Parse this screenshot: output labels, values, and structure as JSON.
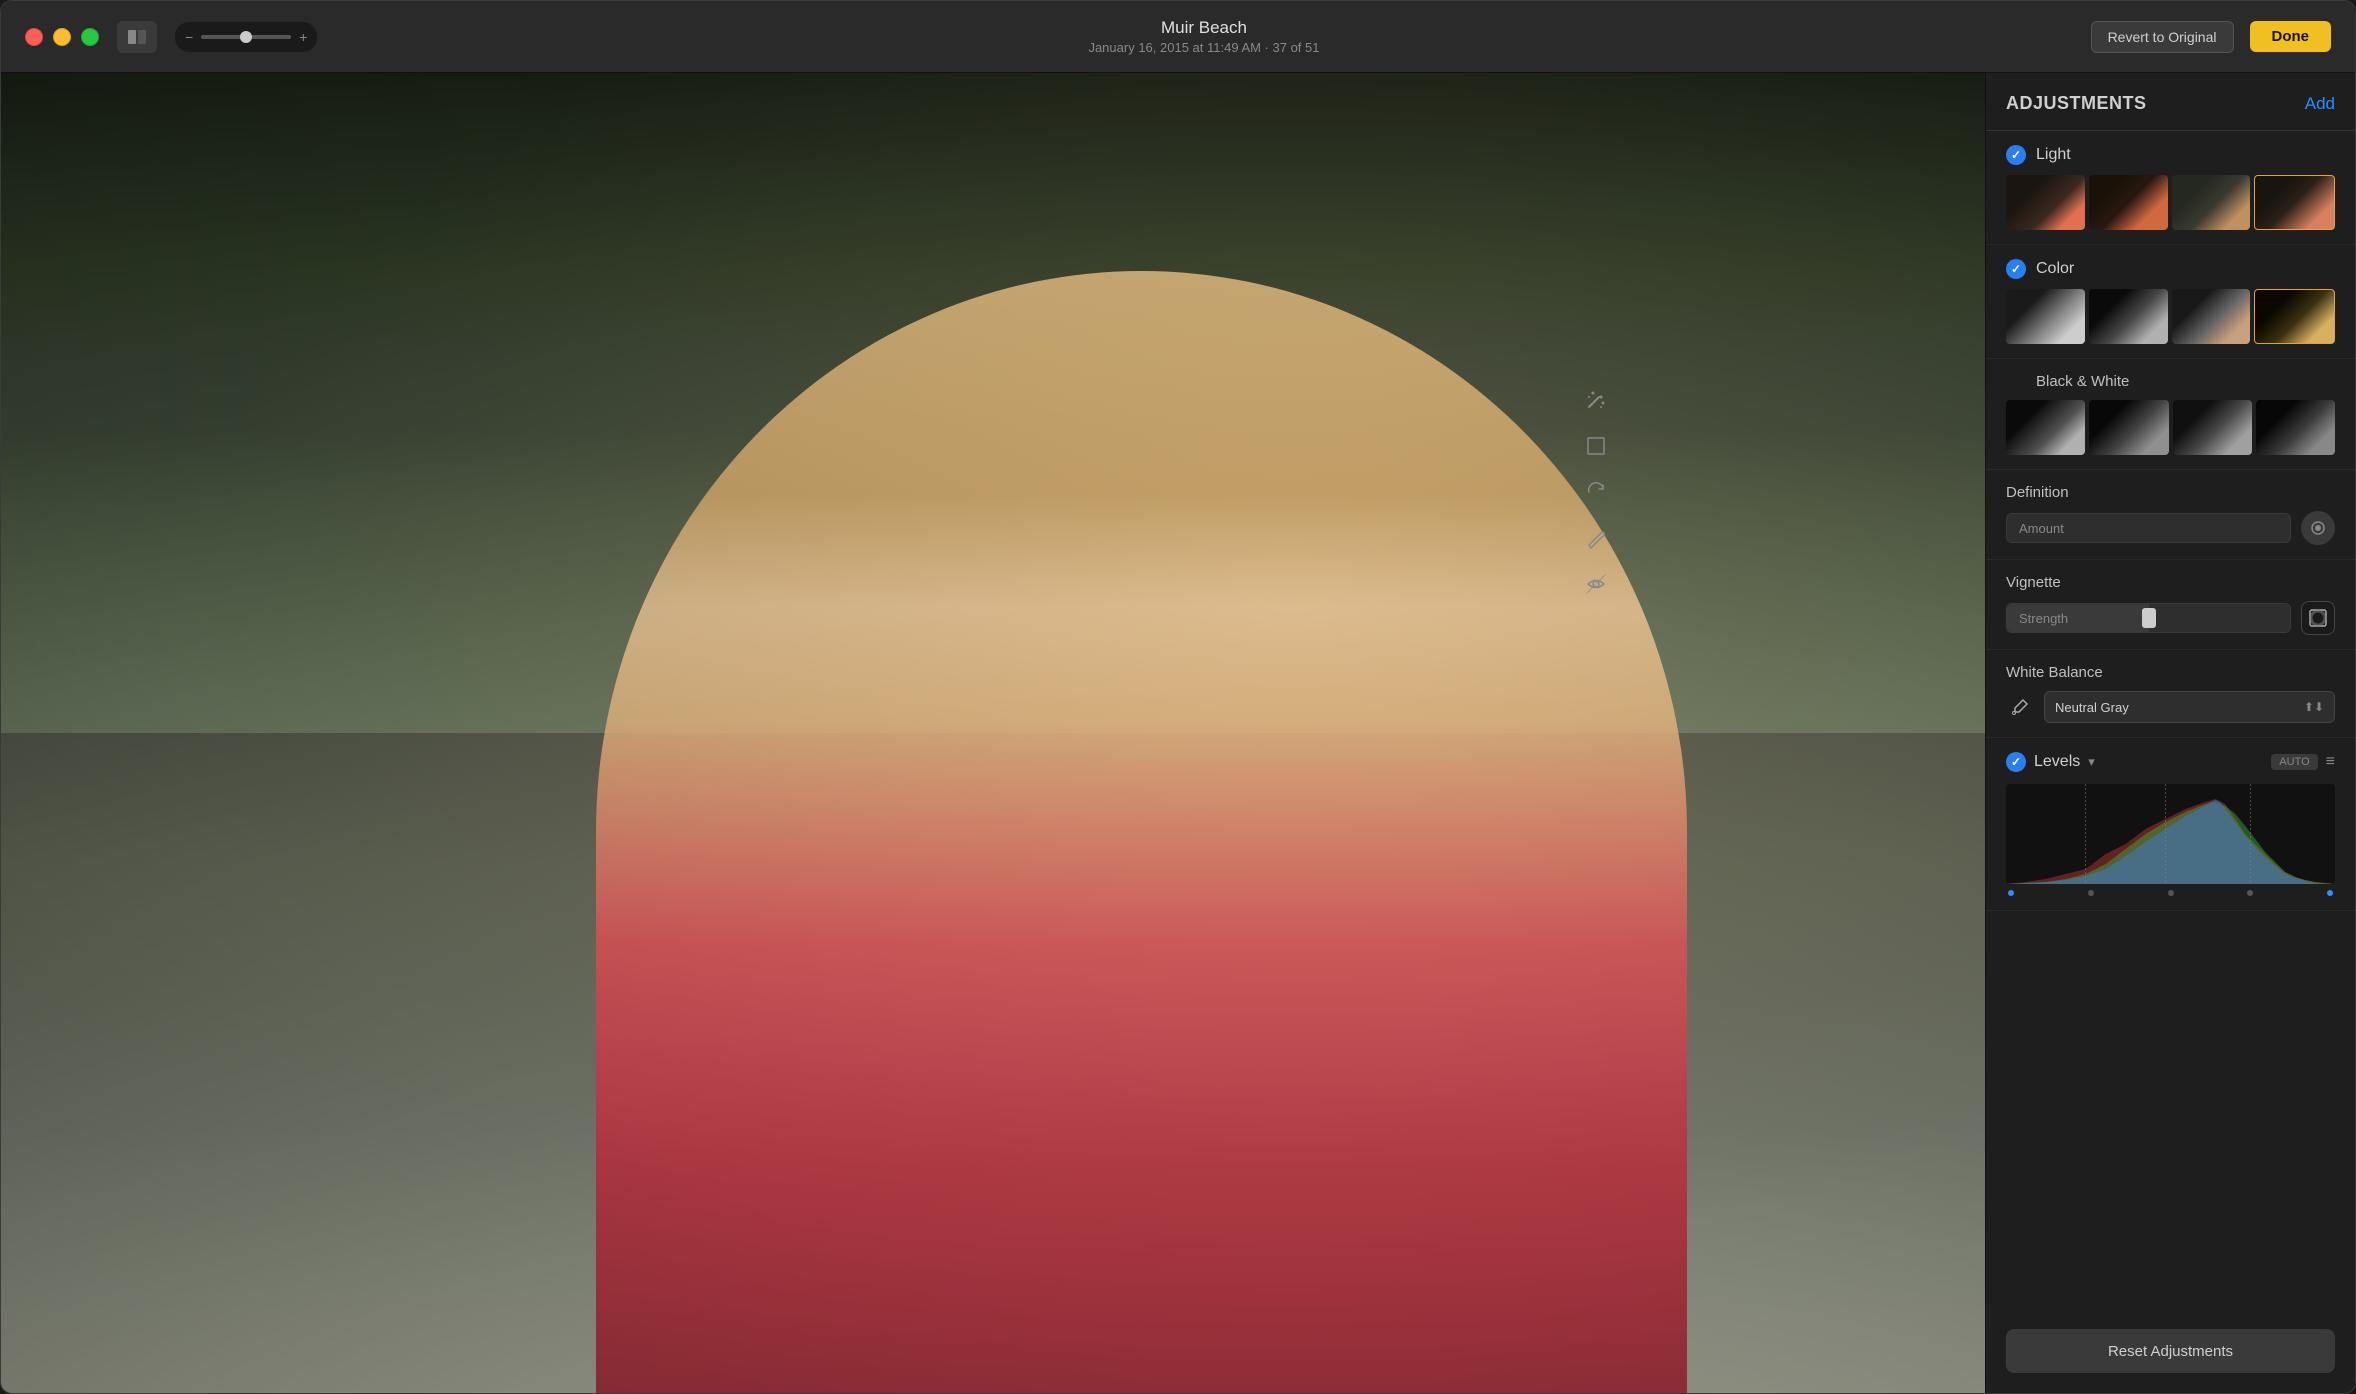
{
  "window": {
    "title": "Muir Beach",
    "subtitle": "January 16, 2015 at 11:49 AM  ·  37 of 51"
  },
  "titlebar": {
    "revert_label": "Revert to Original",
    "done_label": "Done"
  },
  "adjustments": {
    "title": "ADJUSTMENTS",
    "add_label": "Add",
    "light": {
      "label": "Light",
      "checked": true
    },
    "color": {
      "label": "Color",
      "checked": true
    },
    "black_white": {
      "label": "Black & White"
    },
    "definition": {
      "label": "Definition",
      "amount_placeholder": "Amount"
    },
    "vignette": {
      "label": "Vignette",
      "strength_placeholder": "Strength"
    },
    "white_balance": {
      "label": "White Balance",
      "mode": "Neutral Gray"
    },
    "levels": {
      "label": "Levels",
      "auto_label": "AUTO"
    },
    "reset_label": "Reset Adjustments"
  }
}
